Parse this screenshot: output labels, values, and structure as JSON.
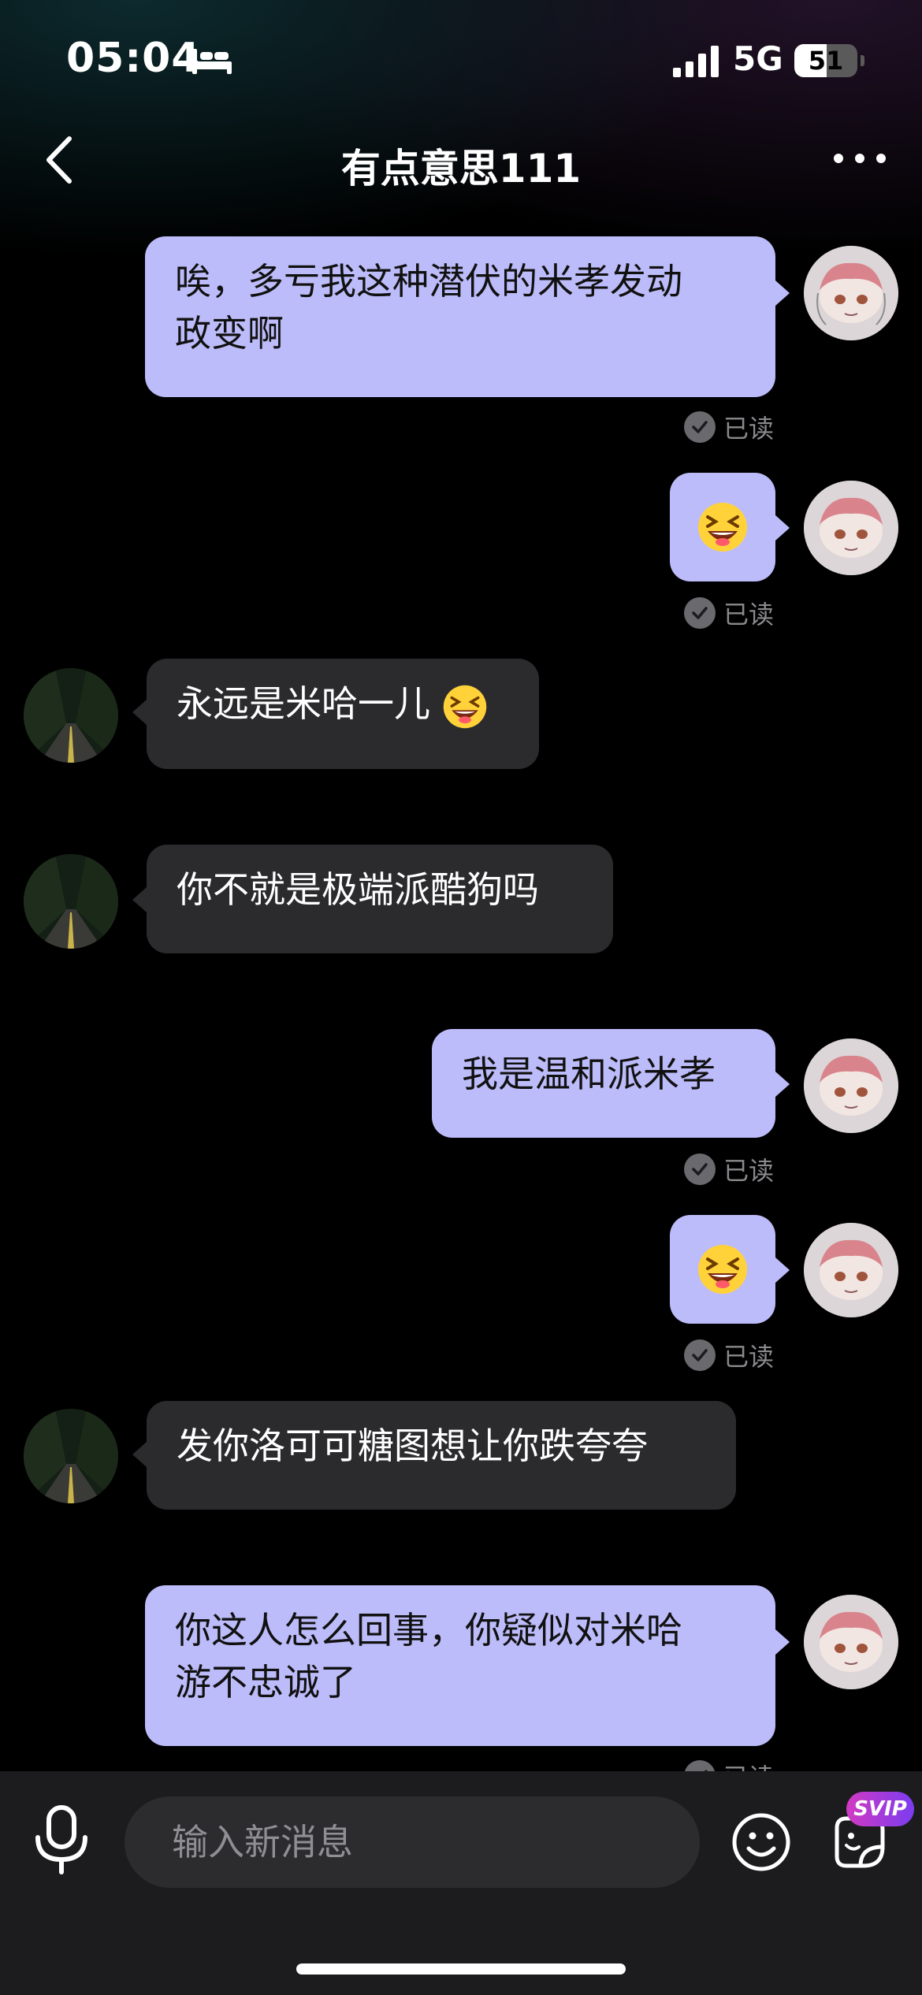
{
  "status_bar": {
    "time": "05:04",
    "network": "5G",
    "battery_percent": "51",
    "battery_level": 0.51,
    "icons": [
      "bed-icon",
      "signal-icon",
      "battery-icon"
    ]
  },
  "nav": {
    "title": "有点意思111",
    "icons": [
      "back-chevron-icon",
      "more-dots-icon"
    ]
  },
  "messages": [
    {
      "from": "self",
      "type": "text",
      "lines": [
        "唉，多亏我这种潜伏的米孝发动",
        "政变啊"
      ],
      "status": "已读"
    },
    {
      "from": "self",
      "type": "emoji",
      "emoji": "grinning-squint-emoji",
      "status": "已读"
    },
    {
      "from": "other",
      "type": "text",
      "lines": [
        "永远是米哈一儿"
      ],
      "emoji": "grinning-squint-emoji"
    },
    {
      "from": "other",
      "type": "text",
      "lines": [
        "你不就是极端派酷狗吗"
      ]
    },
    {
      "from": "self",
      "type": "text",
      "lines": [
        "我是温和派米孝"
      ],
      "status": "已读"
    },
    {
      "from": "self",
      "type": "emoji",
      "emoji": "grinning-squint-emoji",
      "status": "已读"
    },
    {
      "from": "other",
      "type": "text",
      "lines": [
        "发你洛可可糖图想让你跌夸夸"
      ]
    },
    {
      "from": "self",
      "type": "text",
      "lines": [
        "你这人怎么回事，你疑似对米哈",
        "游不忠诚了"
      ],
      "status": "已读"
    }
  ],
  "input_bar": {
    "placeholder": "输入新消息",
    "svip_badge": "SVIP",
    "icons": [
      "microphone-icon",
      "smiley-icon",
      "sticker-icon"
    ]
  },
  "colors": {
    "sent_bubble": "#bdbcfa",
    "received_bubble": "#2b2b2e",
    "background": "#000000",
    "input_bar": "#1c1c1e",
    "svip_gradient_start": "#d23ac3",
    "svip_gradient_end": "#7a3cf0"
  }
}
